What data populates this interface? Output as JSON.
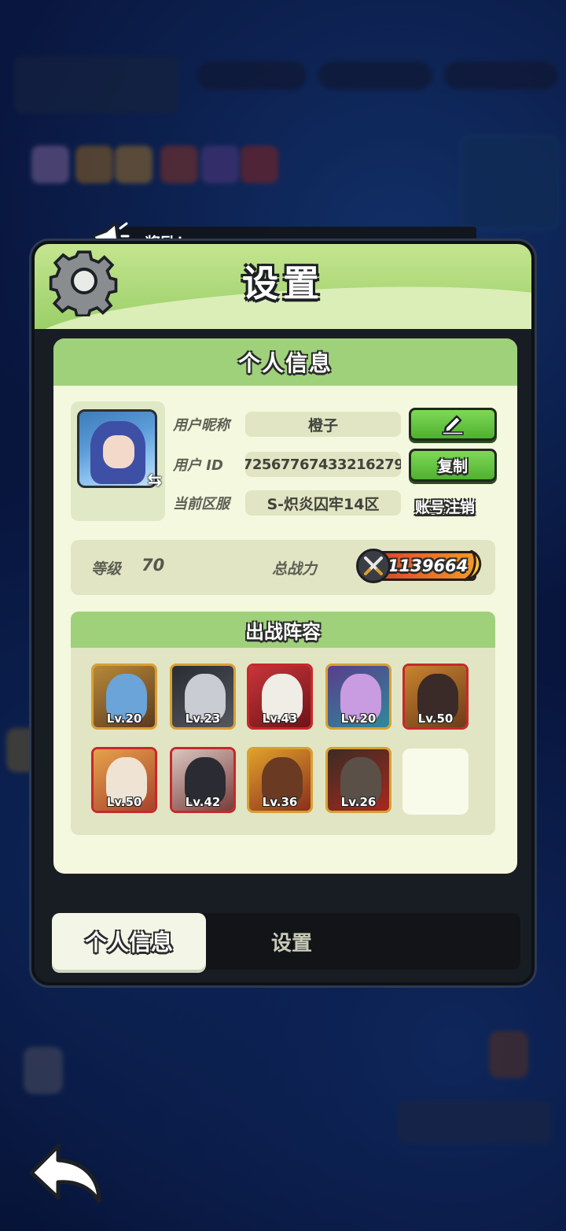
{
  "banner": {
    "text": "⋯奖励！"
  },
  "modal": {
    "title": "设置",
    "section_title": "个人信息",
    "profile": {
      "nickname_label": "用户昵称",
      "nickname_value": "橙子",
      "id_label": "用户  ID",
      "id_value": "7256776743321627​9",
      "server_label": "当前区服",
      "server_value": "S-炽炎囚牢14区",
      "copy_label": "复制",
      "delete_account_label": "账号注销"
    },
    "stats": {
      "level_label": "等级",
      "level_value": "70",
      "power_label": "总战力",
      "power_value": "1139664"
    },
    "lineup": {
      "title": "出战阵容",
      "heroes": [
        {
          "level": "Lv.20",
          "frame": "gold"
        },
        {
          "level": "Lv.23",
          "frame": "gold"
        },
        {
          "level": "Lv.43",
          "frame": "red"
        },
        {
          "level": "Lv.20",
          "frame": "gold"
        },
        {
          "level": "Lv.50",
          "frame": "red"
        },
        {
          "level": "Lv.50",
          "frame": "red"
        },
        {
          "level": "Lv.42",
          "frame": "red"
        },
        {
          "level": "Lv.36",
          "frame": "gold"
        },
        {
          "level": "Lv.26",
          "frame": "gold"
        }
      ]
    },
    "tabs": {
      "active": "个人信息",
      "inactive": "设置"
    }
  },
  "colors": {
    "panel_bg": "#f3f8de",
    "header_green": "#9fd07a",
    "button_green": "#4fb12f",
    "frame_gold": "#d8a032",
    "frame_red": "#c8282a"
  },
  "icons": [
    "gear-icon",
    "megaphone-icon",
    "edit-icon",
    "swap-icon",
    "swords-icon",
    "back-arrow-icon"
  ]
}
